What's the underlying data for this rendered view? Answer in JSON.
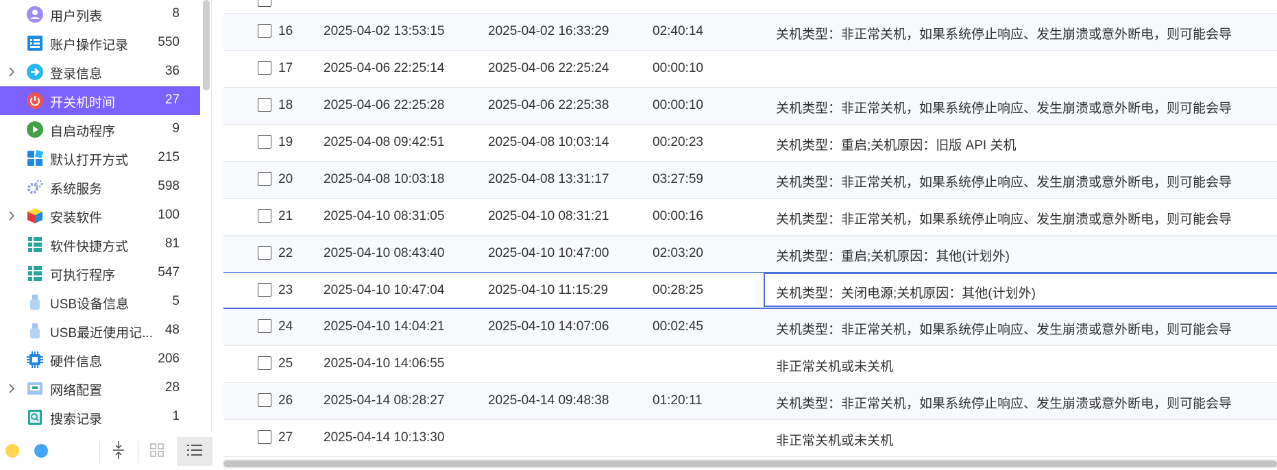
{
  "sidebar": {
    "items": [
      {
        "label": "用户列表",
        "count": "8",
        "icon": "user-list-icon",
        "expandable": false,
        "active": false
      },
      {
        "label": "账户操作记录",
        "count": "550",
        "icon": "account-log-icon",
        "expandable": false,
        "active": false
      },
      {
        "label": "登录信息",
        "count": "36",
        "icon": "login-info-icon",
        "expandable": true,
        "active": false
      },
      {
        "label": "开关机时间",
        "count": "27",
        "icon": "power-icon",
        "expandable": false,
        "active": true
      },
      {
        "label": "自启动程序",
        "count": "9",
        "icon": "autostart-play-icon",
        "expandable": false,
        "active": false
      },
      {
        "label": "默认打开方式",
        "count": "215",
        "icon": "default-open-icon",
        "expandable": false,
        "active": false
      },
      {
        "label": "系统服务",
        "count": "598",
        "icon": "gear-service-icon",
        "expandable": false,
        "active": false
      },
      {
        "label": "安装软件",
        "count": "100",
        "icon": "software-box-icon",
        "expandable": true,
        "active": false
      },
      {
        "label": "软件快捷方式",
        "count": "81",
        "icon": "shortcut-list-icon",
        "expandable": false,
        "active": false
      },
      {
        "label": "可执行程序",
        "count": "547",
        "icon": "executable-list-icon",
        "expandable": false,
        "active": false
      },
      {
        "label": "USB设备信息",
        "count": "5",
        "icon": "usb-icon",
        "expandable": false,
        "active": false
      },
      {
        "label": "USB最近使用记...",
        "count": "48",
        "icon": "usb-history-icon",
        "expandable": false,
        "active": false
      },
      {
        "label": "硬件信息",
        "count": "206",
        "icon": "chip-icon",
        "expandable": false,
        "active": false
      },
      {
        "label": "网络配置",
        "count": "28",
        "icon": "network-icon",
        "expandable": true,
        "active": false
      },
      {
        "label": "搜索记录",
        "count": "1",
        "icon": "search-record-icon",
        "expandable": false,
        "active": false
      }
    ]
  },
  "colors": {
    "accent": "#7b61ff",
    "selection_border": "#4a6fd8",
    "dot_yellow": "#ffd54f",
    "dot_blue": "#42a5f5"
  },
  "rows": [
    {
      "idx": "16",
      "start": "2025-04-02 13:53:15",
      "end": "2025-04-02 16:33:29",
      "duration": "02:40:14",
      "desc": "关机类型：非正常关机，如果系统停止响应、发生崩溃或意外断电，则可能会导"
    },
    {
      "idx": "17",
      "start": "2025-04-06 22:25:14",
      "end": "2025-04-06 22:25:24",
      "duration": "00:00:10",
      "desc": ""
    },
    {
      "idx": "18",
      "start": "2025-04-06 22:25:28",
      "end": "2025-04-06 22:25:38",
      "duration": "00:00:10",
      "desc": "关机类型：非正常关机，如果系统停止响应、发生崩溃或意外断电，则可能会导"
    },
    {
      "idx": "19",
      "start": "2025-04-08 09:42:51",
      "end": "2025-04-08 10:03:14",
      "duration": "00:20:23",
      "desc": "关机类型：重启;关机原因：旧版 API 关机"
    },
    {
      "idx": "20",
      "start": "2025-04-08 10:03:18",
      "end": "2025-04-08 13:31:17",
      "duration": "03:27:59",
      "desc": "关机类型：非正常关机，如果系统停止响应、发生崩溃或意外断电，则可能会导"
    },
    {
      "idx": "21",
      "start": "2025-04-10 08:31:05",
      "end": "2025-04-10 08:31:21",
      "duration": "00:00:16",
      "desc": "关机类型：非正常关机，如果系统停止响应、发生崩溃或意外断电，则可能会导"
    },
    {
      "idx": "22",
      "start": "2025-04-10 08:43:40",
      "end": "2025-04-10 10:47:00",
      "duration": "02:03:20",
      "desc": "关机类型：重启;关机原因：其他(计划外)"
    },
    {
      "idx": "23",
      "start": "2025-04-10 10:47:04",
      "end": "2025-04-10 11:15:29",
      "duration": "00:28:25",
      "desc": "关机类型：关闭电源;关机原因：其他(计划外)",
      "selected": true
    },
    {
      "idx": "24",
      "start": "2025-04-10 14:04:21",
      "end": "2025-04-10 14:07:06",
      "duration": "00:02:45",
      "desc": "关机类型：非正常关机，如果系统停止响应、发生崩溃或意外断电，则可能会导"
    },
    {
      "idx": "25",
      "start": "2025-04-10 14:06:55",
      "end": "",
      "duration": "",
      "desc": "非正常关机或未关机"
    },
    {
      "idx": "26",
      "start": "2025-04-14 08:28:27",
      "end": "2025-04-14 09:48:38",
      "duration": "01:20:11",
      "desc": "关机类型：非正常关机，如果系统停止响应、发生崩溃或意外断电，则可能会导"
    },
    {
      "idx": "27",
      "start": "2025-04-14 10:13:30",
      "end": "",
      "duration": "",
      "desc": "非正常关机或未关机"
    }
  ]
}
